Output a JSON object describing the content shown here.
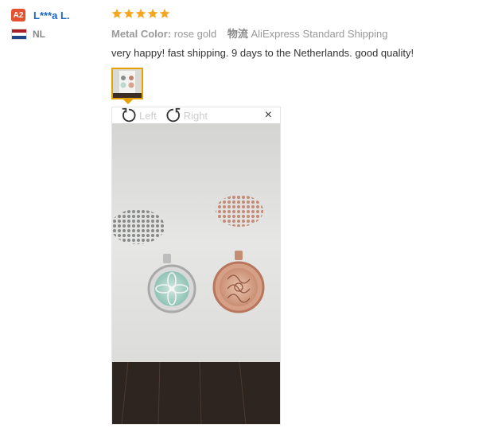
{
  "buyer": {
    "level_badge": "A2",
    "name": "L***a L.",
    "country_code": "NL",
    "flag_colors": [
      "#ae1c28",
      "#ffffff",
      "#21468b"
    ]
  },
  "review": {
    "rating": 5,
    "max_rating": 5,
    "star_color": "#f5a623",
    "attribute_label": "Metal Color:",
    "attribute_value": "rose gold",
    "shipping_label": "物流",
    "shipping_value": "AliExpress Standard Shipping",
    "feedback_text": "very happy! fast shipping. 9 days to the Netherlands. good quality!"
  },
  "viewer": {
    "rotate_left_label": "Left",
    "rotate_right_label": "Right",
    "close_label": "×",
    "thumbnail_border_color": "#e5a100"
  }
}
